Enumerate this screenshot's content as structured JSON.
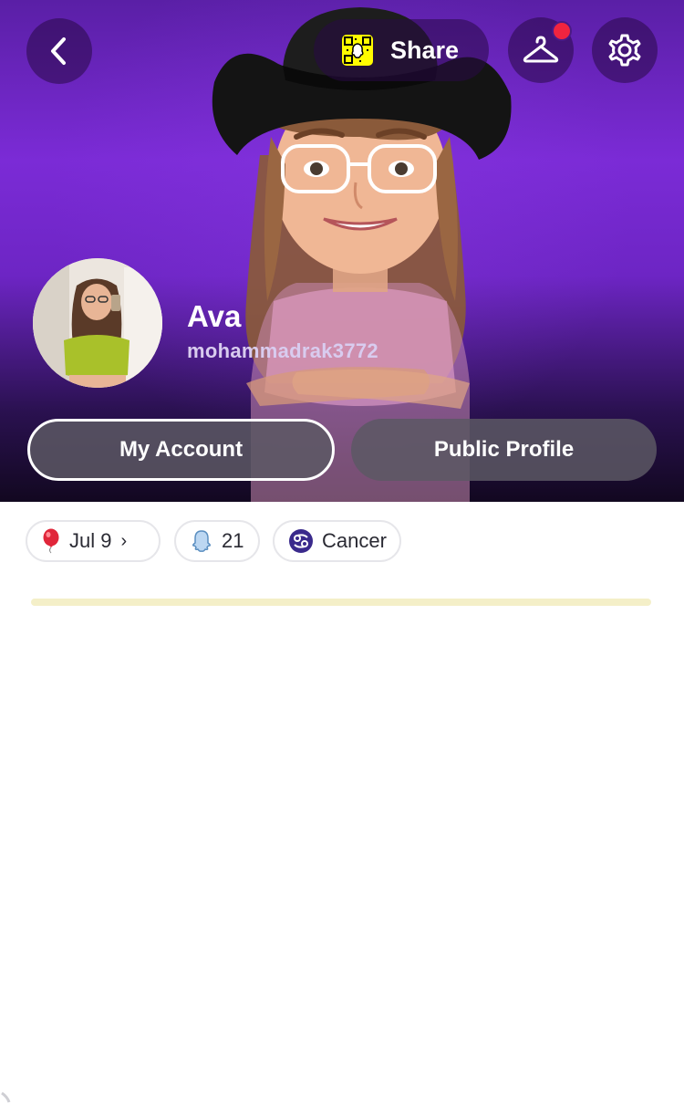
{
  "header": {
    "share_label": "Share"
  },
  "profile": {
    "display_name": "Ava",
    "username": "mohammadrak3772"
  },
  "actions": {
    "my_account": "My Account",
    "public_profile": "Public Profile"
  },
  "chips": {
    "birthday": "Jul 9",
    "friends_count": "21",
    "zodiac": "Cancer"
  },
  "colors": {
    "snap_yellow": "#fffc00",
    "notification_red": "#f0243f",
    "hero_purple": "#7b2bd6"
  },
  "icons": [
    "back-chevron-icon",
    "snapcode-icon",
    "hanger-icon",
    "gear-icon",
    "balloon-icon",
    "ghost-friends-icon",
    "cancer-zodiac-icon"
  ]
}
